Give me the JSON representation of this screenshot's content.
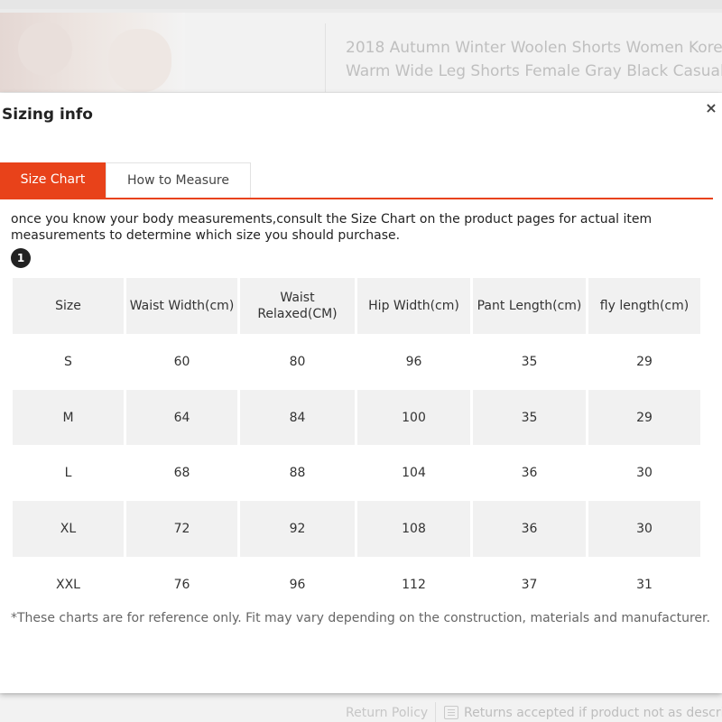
{
  "background": {
    "product_title_line1": "2018 Autumn Winter Woolen Shorts Women Kore",
    "product_title_line2": "Warm Wide Leg Shorts Female Gray Black Casual",
    "footer_return_label": "Return Policy",
    "footer_returns_text": "Returns accepted if product not as describ"
  },
  "modal": {
    "title": "Sizing info",
    "close_label": "×",
    "tabs": [
      {
        "label": "Size Chart",
        "active": true
      },
      {
        "label": "How to Measure",
        "active": false
      }
    ],
    "intro": "once you know your body measurements,consult the Size Chart on the product pages for actual item measurements to determine which size you should purchase.",
    "badge": "1",
    "table": {
      "headers": [
        "Size",
        "Waist Width(cm)",
        "Waist Relaxed(CM)",
        "Hip Width(cm)",
        "Pant Length(cm)",
        "fly length(cm)"
      ],
      "rows": [
        [
          "S",
          "60",
          "80",
          "96",
          "35",
          "29"
        ],
        [
          "M",
          "64",
          "84",
          "100",
          "35",
          "29"
        ],
        [
          "L",
          "68",
          "88",
          "104",
          "36",
          "30"
        ],
        [
          "XL",
          "72",
          "92",
          "108",
          "36",
          "30"
        ],
        [
          "XXL",
          "76",
          "96",
          "112",
          "37",
          "31"
        ]
      ]
    },
    "note": "*These charts are for reference only. Fit may vary depending on the construction, materials and manufacturer."
  },
  "colors": {
    "accent": "#e8421a",
    "header_bg": "#f1f1f1"
  }
}
